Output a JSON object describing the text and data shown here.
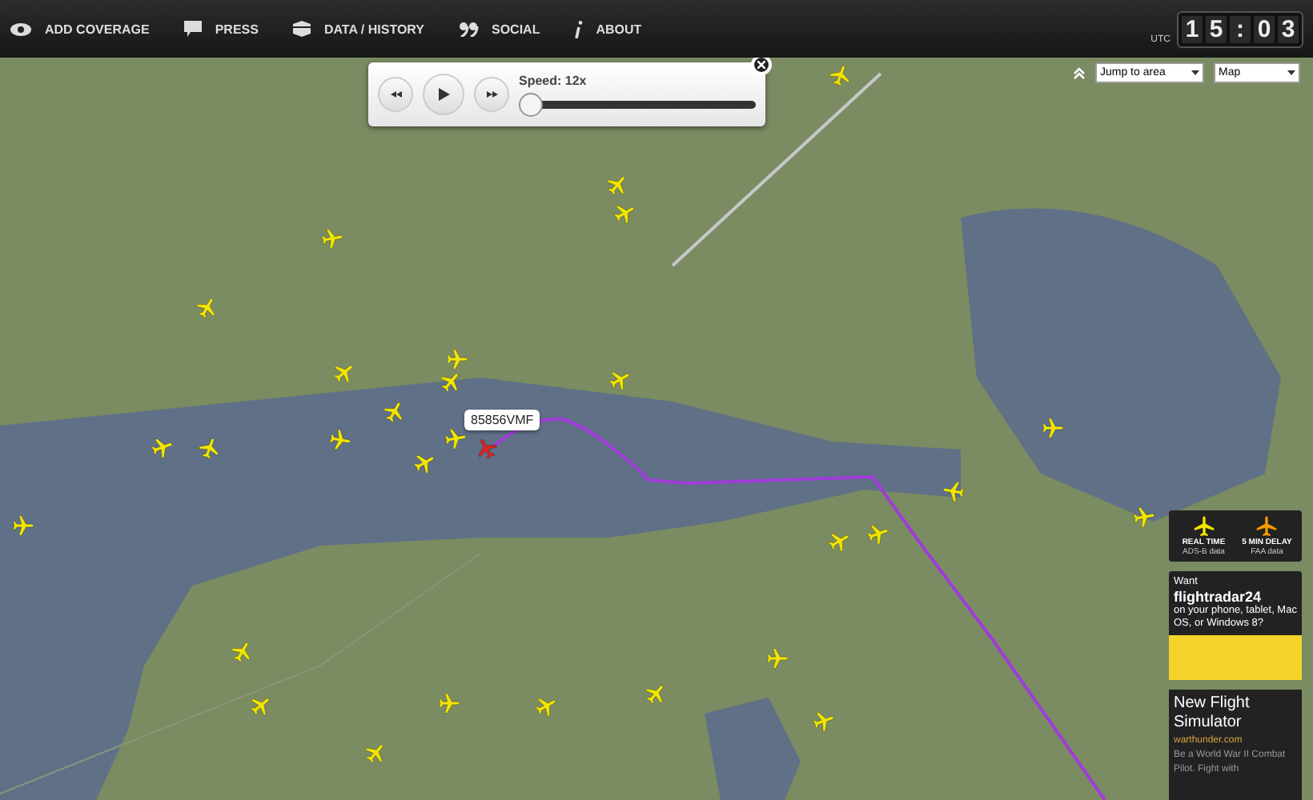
{
  "toolbar": {
    "items": [
      {
        "kind": "eye",
        "label": "ADD COVERAGE"
      },
      {
        "kind": "speech",
        "label": "PRESS"
      },
      {
        "kind": "box",
        "label": "DATA / HISTORY"
      },
      {
        "kind": "quote",
        "label": "SOCIAL"
      },
      {
        "kind": "info",
        "label": "ABOUT"
      }
    ],
    "clock": {
      "label": "UTC",
      "digits": [
        "1",
        "5",
        ":",
        "0",
        "3"
      ]
    }
  },
  "playback": {
    "speed": "Speed: 12x",
    "level": 0.0
  },
  "map_controls": {
    "jump": "Jump to area",
    "map_type": "Map"
  },
  "flight_tag": "85856VMF",
  "planes": [
    {
      "selected": false
    },
    {
      "selected": false
    },
    {
      "selected": false
    },
    {
      "selected": false
    },
    {
      "selected": false
    },
    {
      "selected": false
    },
    {
      "selected": false
    },
    {
      "selected": false
    },
    {
      "selected": false
    },
    {
      "selected": false
    },
    {
      "selected": false
    },
    {
      "selected": false
    },
    {
      "selected": false
    },
    {
      "selected": true
    },
    {
      "selected": false
    },
    {
      "selected": false
    },
    {
      "selected": false
    },
    {
      "selected": false
    },
    {
      "selected": false
    },
    {
      "selected": false
    },
    {
      "selected": false
    },
    {
      "selected": false
    },
    {
      "selected": false
    },
    {
      "selected": false
    },
    {
      "selected": false
    },
    {
      "selected": false
    },
    {
      "selected": false
    },
    {
      "selected": false
    },
    {
      "selected": false
    },
    {
      "selected": false
    }
  ],
  "legend": [
    {
      "title": "REAL TIME",
      "note": "ADS-B data",
      "color": "#f2e600"
    },
    {
      "title": "5 MIN DELAY",
      "note": "FAA data",
      "color": "#f29a00"
    }
  ],
  "promo": {
    "lead": "Want",
    "brand": "flightradar24",
    "text": "on your phone, tablet, Mac OS, or Windows 8?"
  },
  "ad": {
    "title": "New Flight Simulator",
    "domain": "warthunder.com",
    "text": "Be a World War II Combat Pilot. Fight with"
  }
}
